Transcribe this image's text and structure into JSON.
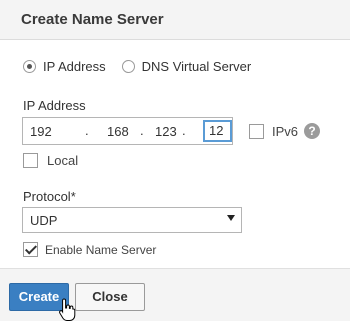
{
  "dialog": {
    "title": "Create Name Server"
  },
  "target_type": {
    "options": [
      {
        "label": "IP Address",
        "selected": true
      },
      {
        "label": "DNS Virtual Server",
        "selected": false
      }
    ]
  },
  "ip_address": {
    "label": "IP Address",
    "octets": [
      "192",
      "168",
      "123",
      "12"
    ],
    "separator": "."
  },
  "ipv6": {
    "label": "IPv6",
    "checked": false,
    "help_icon": "?"
  },
  "local": {
    "label": "Local",
    "checked": false
  },
  "protocol": {
    "label": "Protocol*",
    "value": "UDP"
  },
  "enable_name_server": {
    "label": "Enable Name Server",
    "checked": true
  },
  "buttons": {
    "create": "Create",
    "close": "Close"
  },
  "colors": {
    "accent": "#3a7fc2",
    "focus": "#5a9bd5",
    "header_bg": "#f4f4f4"
  }
}
